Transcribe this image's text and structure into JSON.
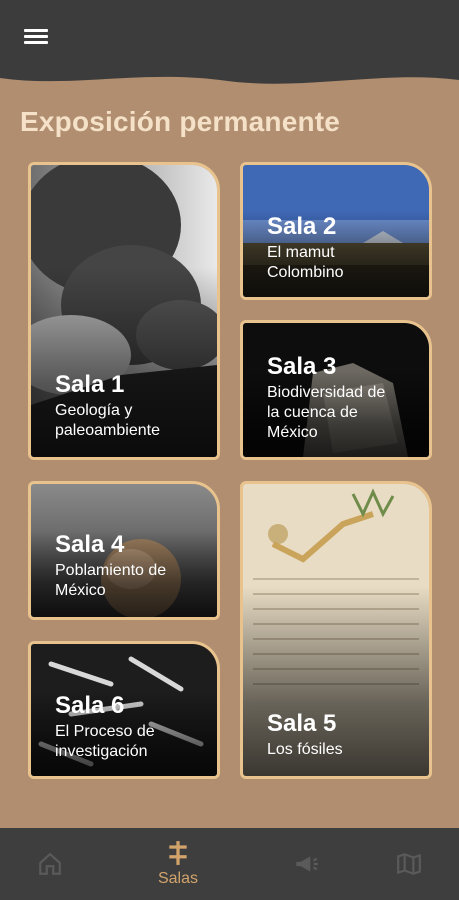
{
  "header": {
    "menu_icon": "hamburger-menu-icon",
    "bar_color": "#3c3c3c"
  },
  "page_title": "Exposición permanente",
  "colors": {
    "background": "#b08e6f",
    "card_border": "#e8c38e",
    "title": "#f4e1c8",
    "nav_active": "#d2a46c",
    "nav_inactive": "#5a5a5a"
  },
  "salas": [
    {
      "number": "Sala 1",
      "description": "Geología y\npaleoambiente",
      "image": "volcano-eruption-smoke"
    },
    {
      "number": "Sala 2",
      "description": "El mamut\nColombino",
      "image": "landscape-with-volcano"
    },
    {
      "number": "Sala 3",
      "description": "Biodiversidad de\nla cuenca de\nMéxico",
      "image": "stone-fossil-dark"
    },
    {
      "number": "Sala 4",
      "description": "Poblamiento de\nMéxico",
      "image": "skull-dark"
    },
    {
      "number": "Sala 5",
      "description": "Los fósiles",
      "image": "ancient-codex-manuscript"
    },
    {
      "number": "Sala 6",
      "description": "El Proceso de\ninvestigación",
      "image": "excavated-bones"
    }
  ],
  "bottom_nav": {
    "items": [
      {
        "icon": "home-icon",
        "label": ""
      },
      {
        "icon": "salas-icon",
        "label": "Salas",
        "active": true
      },
      {
        "icon": "megaphone-icon",
        "label": ""
      },
      {
        "icon": "map-icon",
        "label": ""
      }
    ]
  }
}
